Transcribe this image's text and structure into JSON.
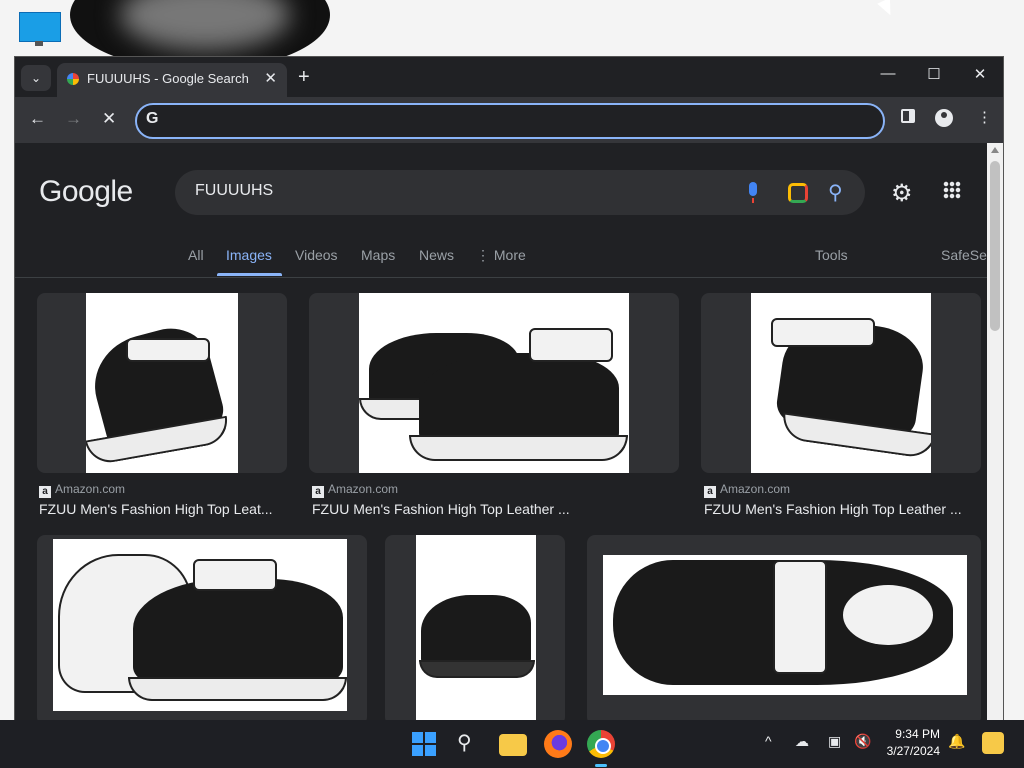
{
  "window": {
    "tab_title": "FUUUUHS - Google Search",
    "new_tab": "+",
    "dropdown": "⌄",
    "close_tab": "✕",
    "minimize": "—",
    "maximize": "☐",
    "close": "✕"
  },
  "toolbar": {
    "back": "←",
    "forward": "→",
    "stop": "✕",
    "omnibox_g": "G",
    "omnibox_value": "",
    "menu": "⋮"
  },
  "google": {
    "logo": "Google",
    "query": "FUUUUHS",
    "filters": [
      "All",
      "Images",
      "Videos",
      "Maps",
      "News",
      "More"
    ],
    "more_icon": "⋮",
    "tools": "Tools",
    "safesearch": "SafeSe"
  },
  "results": [
    {
      "source": "Amazon.com",
      "title": "FZUU Men's Fashion High Top Leat..."
    },
    {
      "source": "Amazon.com",
      "title": "FZUU Men's Fashion High Top Leather ..."
    },
    {
      "source": "Amazon.com",
      "title": "FZUU Men's Fashion High Top Leather ..."
    }
  ],
  "taskbar": {
    "time": "9:34 PM",
    "date": "3/27/2024",
    "tray_chevron": "^"
  },
  "colors": {
    "accent": "#8ab4f8",
    "page_bg": "#202124",
    "card_bg": "#303134"
  }
}
